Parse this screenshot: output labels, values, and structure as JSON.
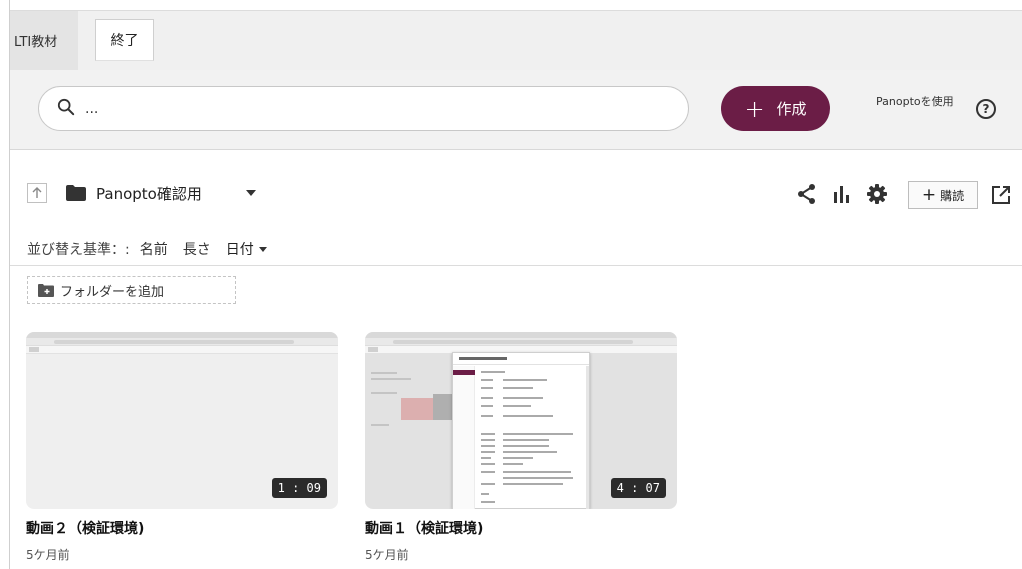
{
  "tabs": {
    "lti_label": "LTI教材",
    "end_label": "終了"
  },
  "search": {
    "placeholder": "...",
    "create_label": "作成",
    "use_panopto_label": "Panoptoを使用",
    "help_symbol": "?"
  },
  "folder": {
    "name": "Panopto確認用",
    "subscribe_label": "購読"
  },
  "sort": {
    "label": "並び替え基準：:",
    "options": [
      "名前",
      "長さ",
      "日付"
    ],
    "active": "日付"
  },
  "add_folder_label": "フォルダーを追加",
  "videos": [
    {
      "title": "動画２（検証環境)",
      "age": "5ケ月前",
      "duration": "1 : 09"
    },
    {
      "title": "動画１（検証環境)",
      "age": "5ケ月前",
      "duration": "4 : 07"
    }
  ],
  "colors": {
    "accent": "#6b1d46",
    "header_bg": "#f2f2f2"
  }
}
